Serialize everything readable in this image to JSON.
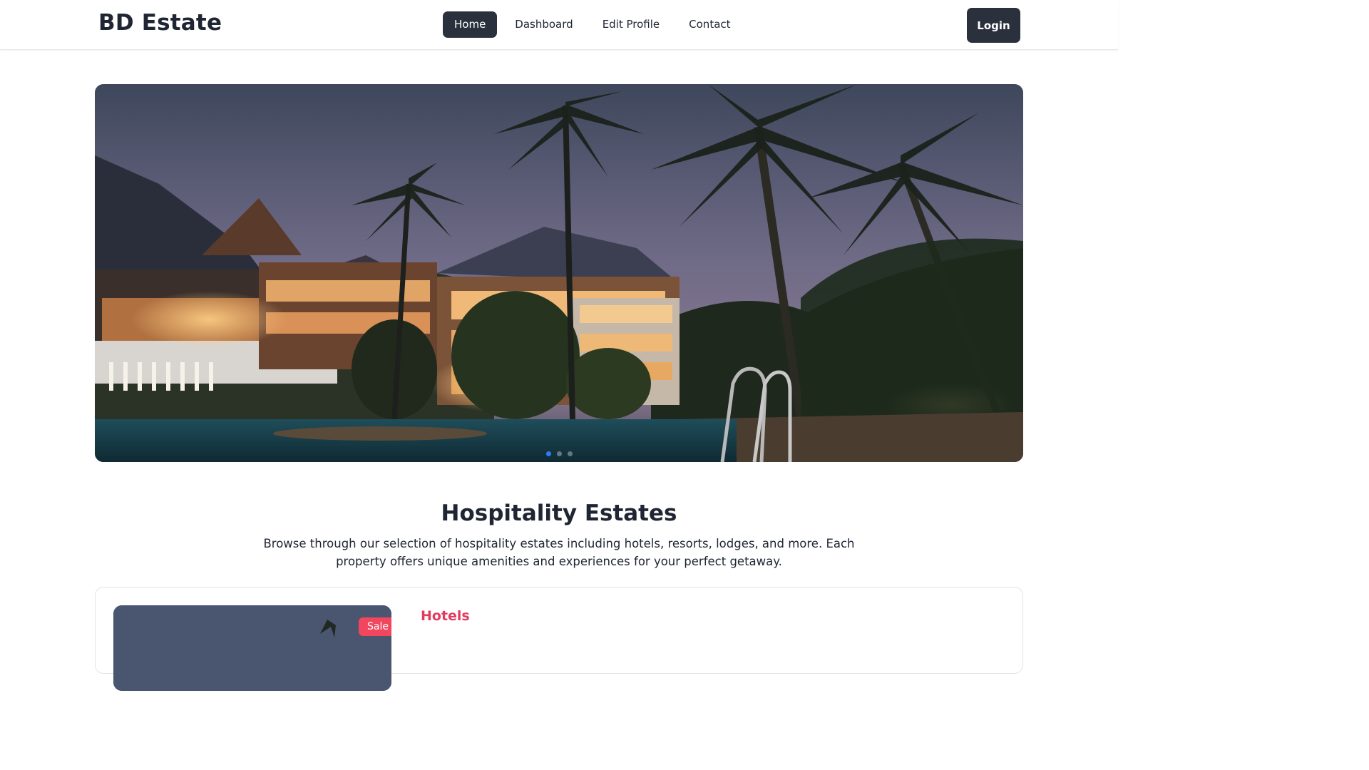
{
  "navbar": {
    "brand": "BD Estate",
    "links": [
      {
        "label": "Home",
        "active": true
      },
      {
        "label": "Dashboard",
        "active": false
      },
      {
        "label": "Edit Profile",
        "active": false
      },
      {
        "label": "Contact",
        "active": false
      }
    ],
    "login_label": "Login"
  },
  "hero": {
    "slide_count": 3,
    "active_slide": 1
  },
  "section": {
    "title": "Hospitality Estates",
    "description": "Browse through our selection of hospitality estates including hotels, resorts, lodges, and more. Each property offers unique amenities and experiences for your perfect getaway."
  },
  "card": {
    "badge": "Sale",
    "category": "Hotels"
  },
  "colors": {
    "primary_dark": "#2a303c",
    "accent_pink": "#e23b5e",
    "badge_red": "#f2465f",
    "dot_active": "#2f7bf5"
  }
}
